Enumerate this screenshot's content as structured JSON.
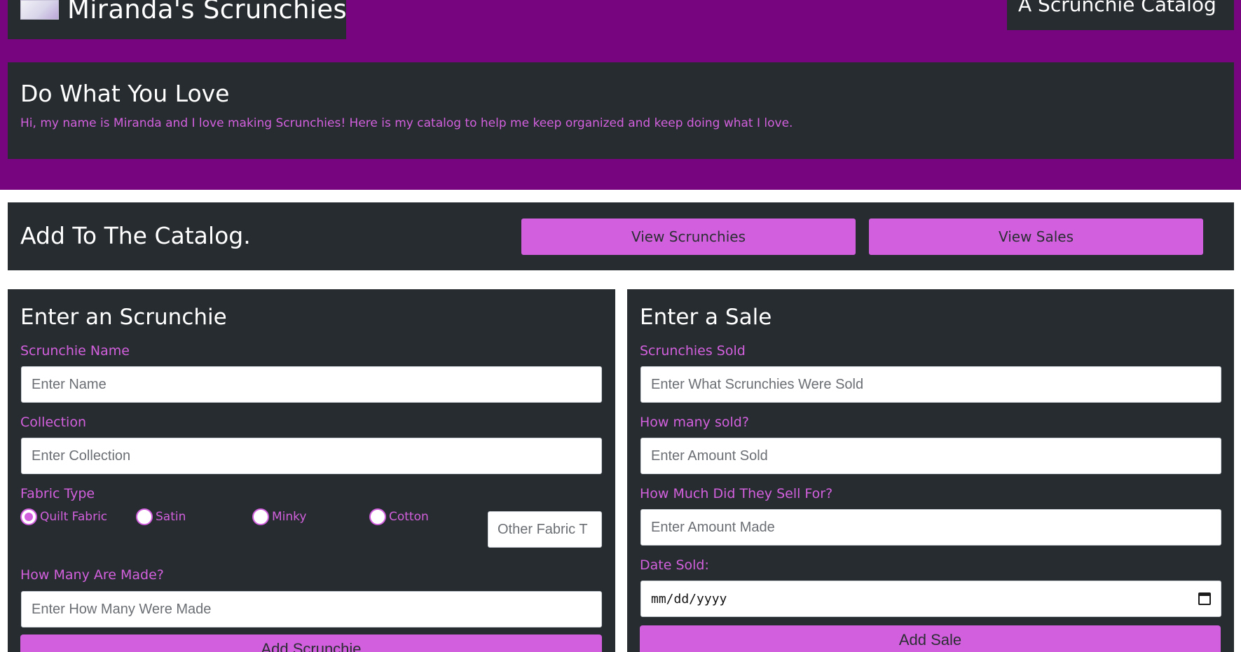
{
  "header": {
    "brand_title": "Miranda's Scrunchies",
    "logo_icon": "logo-image",
    "catalog_title": "A Scrunchie Catalog"
  },
  "hero": {
    "title": "Do What You Love",
    "text": "Hi, my name is Miranda and I love making Scrunchies! Here is my catalog to help me keep organized and keep doing what I love."
  },
  "nav": {
    "title": "Add To The Catalog.",
    "view_scrunchies": "View Scrunchies",
    "view_sales": "View Sales"
  },
  "scrunchie_form": {
    "title": "Enter an Scrunchie",
    "name_label": "Scrunchie Name",
    "name_placeholder": "Enter Name",
    "collection_label": "Collection",
    "collection_placeholder": "Enter Collection",
    "fabric_label": "Fabric Type",
    "fabric_options": [
      {
        "label": "Quilt Fabric",
        "checked": true
      },
      {
        "label": "Satin",
        "checked": false
      },
      {
        "label": "Minky",
        "checked": false
      },
      {
        "label": "Cotton",
        "checked": false
      }
    ],
    "other_fabric_placeholder": "Other Fabric T",
    "made_label": "How Many Are Made?",
    "made_placeholder": "Enter How Many Were Made",
    "submit_label": "Add Scrunchie"
  },
  "sale_form": {
    "title": "Enter a Sale",
    "sold_label": "Scrunchies Sold",
    "sold_placeholder": "Enter What Scrunchies Were Sold",
    "amount_label": "How many sold?",
    "amount_placeholder": "Enter Amount Sold",
    "price_label": "How Much Did They Sell For?",
    "price_placeholder": "Enter Amount Made",
    "date_label": "Date Sold:",
    "date_placeholder": "mm/dd/yyyy",
    "submit_label": "Add Sale"
  },
  "colors": {
    "brand_purple": "#780580",
    "panel_dark": "#272c30",
    "accent_pink": "#d15fde"
  }
}
